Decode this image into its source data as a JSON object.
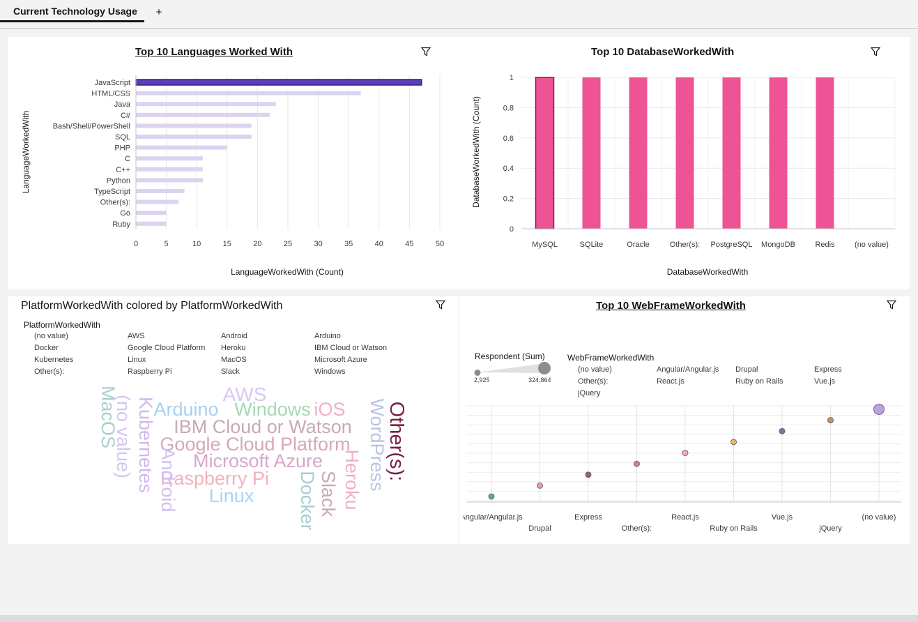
{
  "tab": {
    "label": "Current Technology Usage",
    "add_label": "+"
  },
  "languages": {
    "title": "Top 10 Languages Worked With",
    "chart_data": {
      "type": "bar",
      "title": "Top 10 Languages Worked With",
      "xlabel": "LanguageWorkedWith (Count)",
      "ylabel": "LanguageWorkedWith",
      "xlim": [
        0,
        50
      ],
      "xticks": [
        0,
        5,
        10,
        15,
        20,
        25,
        30,
        35,
        40,
        45,
        50
      ],
      "categories": [
        "JavaScript",
        "HTML/CSS",
        "Java",
        "C#",
        "Bash/Shell/PowerShell",
        "SQL",
        "PHP",
        "C",
        "C++",
        "Python",
        "TypeScript",
        "Other(s):",
        "Go",
        "Ruby"
      ],
      "values": [
        47,
        37,
        23,
        22,
        19,
        19,
        15,
        11,
        11,
        11,
        8,
        7,
        5,
        5
      ],
      "colors": {
        "selected": "#5a3fb5",
        "default": "#dcd3f0"
      }
    }
  },
  "databases": {
    "title": "Top 10 DatabaseWorkedWith",
    "chart_data": {
      "type": "bar",
      "title": "Top 10 DatabaseWorkedWith",
      "xlabel": "DatabaseWorkedWith",
      "ylabel": "DatabaseWorkedWith (Count)",
      "ylim": [
        0,
        1
      ],
      "yticks": [
        "0",
        "0.2",
        "0.4",
        "0.6",
        "0.8",
        "1"
      ],
      "categories": [
        "MySQL",
        "SQLite",
        "Oracle",
        "Other(s):",
        "PostgreSQL",
        "MongoDB",
        "Redis",
        "(no value)"
      ],
      "values": [
        1,
        1,
        1,
        1,
        1,
        1,
        1,
        0
      ],
      "colors": {
        "bar": "#ee5396"
      }
    }
  },
  "platforms": {
    "title": "PlatformWorkedWith colored by PlatformWorkedWith",
    "legend_title": "PlatformWorkedWith",
    "legend_items": [
      "(no value)",
      "AWS",
      "Android",
      "Arduino",
      "Docker",
      "Google Cloud Platform",
      "Heroku",
      "IBM Cloud or Watson",
      "Kubernetes",
      "Linux",
      "MacOS",
      "Microsoft Azure",
      "Other(s):",
      "Raspberry Pi",
      "Slack",
      "Windows"
    ],
    "words": [
      {
        "text": "AWS",
        "color": "#d8c8f4"
      },
      {
        "text": "Arduino",
        "color": "#a8d0f0"
      },
      {
        "text": "Windows",
        "color": "#a8d8b4"
      },
      {
        "text": "iOS",
        "color": "#f2b0c8"
      },
      {
        "text": "IBM Cloud or Watson",
        "color": "#c8aab4"
      },
      {
        "text": "Google Cloud Platform",
        "color": "#d6a8ba"
      },
      {
        "text": "Microsoft Azure",
        "color": "#d6a8ca"
      },
      {
        "text": "Raspberry Pi",
        "color": "#f5b0bc"
      },
      {
        "text": "Linux",
        "color": "#a8d4f2"
      },
      {
        "text": "MacOS",
        "color": "#a8d0cc"
      },
      {
        "text": "(no value)",
        "color": "#d4c6f0"
      },
      {
        "text": "Kubernetes",
        "color": "#d0b8ec"
      },
      {
        "text": "Android",
        "color": "#d2c0f2"
      },
      {
        "text": "Docker",
        "color": "#a8ccd4"
      },
      {
        "text": "Slack",
        "color": "#c4aab4"
      },
      {
        "text": "Heroku",
        "color": "#f2b0bc"
      },
      {
        "text": "WordPress",
        "color": "#b8c4e4"
      },
      {
        "text": "Other(s):",
        "color": "#7a1f4a"
      }
    ]
  },
  "webframes": {
    "title": "Top 10 WebFrameWorkedWith",
    "size_legend_title": "Respondent (Sum)",
    "size_min_label": "2,925",
    "size_max_label": "324,864",
    "legend_title": "WebFrameWorkedWith",
    "legend_items": [
      "(no value)",
      "Angular/Angular.js",
      "Drupal",
      "Express",
      "Other(s):",
      "React.js",
      "Ruby on Rails",
      "Vue.js",
      "jQuery"
    ],
    "chart_data": {
      "type": "scatter",
      "title": "Top 10 WebFrameWorkedWith",
      "categories": [
        "Angular/Angular.js",
        "Drupal",
        "Express",
        "Other(s):",
        "React.js",
        "Ruby on Rails",
        "Vue.js",
        "jQuery",
        "(no value)"
      ],
      "y_rank": [
        1,
        2,
        3,
        4,
        5,
        6,
        7,
        8,
        9
      ],
      "colors": [
        "#3d9e9b",
        "#f28b9a",
        "#8a4a4a",
        "#c96a8e",
        "#f59ab8",
        "#f2a95a",
        "#4a6a9a",
        "#b8824a",
        "#b28ee8"
      ]
    }
  }
}
